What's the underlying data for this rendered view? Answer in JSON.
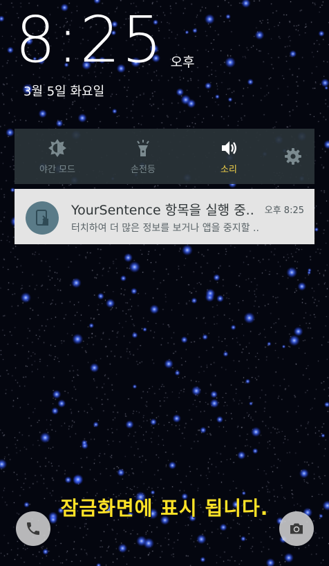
{
  "clock": {
    "time": "8:25",
    "ampm": "오후"
  },
  "date": "3월 5일 화요일",
  "quick_settings": {
    "items": [
      {
        "label": "야간 모드",
        "icon": "night-mode-icon",
        "active": false
      },
      {
        "label": "손전등",
        "icon": "flashlight-icon",
        "active": false
      },
      {
        "label": "소리",
        "icon": "sound-icon",
        "active": true
      }
    ],
    "settings_icon": "gear-icon",
    "active_color": "#f4d34a",
    "inactive_color": "#7b8a8f"
  },
  "notification": {
    "app_icon": "app-screen-icon",
    "title": "YourSentence 항목을 실행 중..",
    "time": "오후 8:25",
    "text": "터치하여 더 많은 정보를 보거나 앱을 중지할 .."
  },
  "banner": "잠금화면에 표시 됩니다.",
  "bottom_icons": {
    "left": "phone-icon",
    "right": "camera-icon"
  },
  "colors": {
    "background": "#04060f",
    "banner": "#ffe327",
    "notification_bg": "#e4e4e4"
  }
}
